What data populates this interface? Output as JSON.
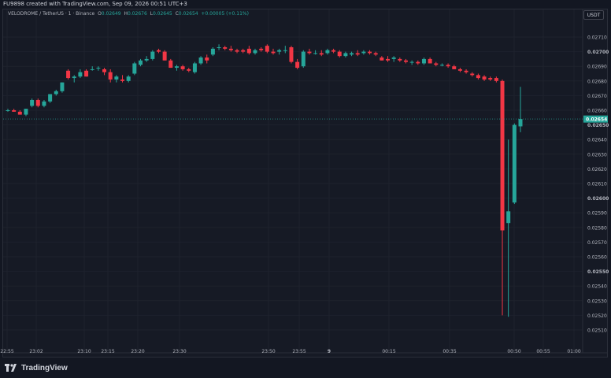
{
  "header": {
    "attribution": "FU9898 created with TradingView.com, Sep 09, 2026 00:51 UTC+3"
  },
  "legend": {
    "symbol": "VELODROME / TetherUS · 1 · Binance",
    "open_label": "O",
    "open": "0.02649",
    "high_label": "H",
    "high": "0.02676",
    "low_label": "L",
    "low": "0.02645",
    "close_label": "C",
    "close": "0.02654",
    "change": "+0.00005 (+0.11%)"
  },
  "currency_button": "USDT",
  "logo_text": "TradingView",
  "colors": {
    "up": "#26a69a",
    "down": "#f23645",
    "background": "#161a25",
    "grid": "#1e222d",
    "text": "#b2b5be",
    "price_line": "#26a69a"
  },
  "chart_data": {
    "type": "candlestick",
    "symbol": "VELODROME / TetherUS",
    "interval": "1",
    "exchange": "Binance",
    "ylim": [
      0.02512,
      0.02715
    ],
    "y_ticks": [
      "0.02710",
      "0.02700",
      "0.02690",
      "0.02680",
      "0.02670",
      "0.02660",
      "0.02650",
      "0.02640",
      "0.02630",
      "0.02620",
      "0.02610",
      "0.02600",
      "0.02590",
      "0.02580",
      "0.02570",
      "0.02560",
      "0.02550",
      "0.02540",
      "0.02530",
      "0.02520",
      "0.02510"
    ],
    "y_ticks_bold": [
      "0.02700",
      "0.02650",
      "0.02600",
      "0.02550"
    ],
    "x_ticks": [
      "22:55",
      "23:02",
      "23:10",
      "23:15",
      "23:20",
      "23:30",
      "23:50",
      "23:55",
      "9",
      "00:15",
      "00:35",
      "00:50",
      "00:55",
      "01:00"
    ],
    "current_price": "0.02654",
    "candles": [
      {
        "o": 0.0266,
        "h": 0.02661,
        "l": 0.02659,
        "c": 0.0266
      },
      {
        "o": 0.0266,
        "h": 0.02661,
        "l": 0.02659,
        "c": 0.02659
      },
      {
        "o": 0.02659,
        "h": 0.0266,
        "l": 0.02657,
        "c": 0.02657
      },
      {
        "o": 0.02657,
        "h": 0.02661,
        "l": 0.02656,
        "c": 0.02661
      },
      {
        "o": 0.02663,
        "h": 0.02668,
        "l": 0.02662,
        "c": 0.02667
      },
      {
        "o": 0.02667,
        "h": 0.02668,
        "l": 0.02662,
        "c": 0.02663
      },
      {
        "o": 0.02663,
        "h": 0.02667,
        "l": 0.02662,
        "c": 0.02666
      },
      {
        "o": 0.02666,
        "h": 0.02671,
        "l": 0.02665,
        "c": 0.02671
      },
      {
        "o": 0.02671,
        "h": 0.02674,
        "l": 0.0267,
        "c": 0.02673
      },
      {
        "o": 0.02673,
        "h": 0.02679,
        "l": 0.02672,
        "c": 0.02679
      },
      {
        "o": 0.02687,
        "h": 0.02688,
        "l": 0.02681,
        "c": 0.02682
      },
      {
        "o": 0.02682,
        "h": 0.02684,
        "l": 0.02679,
        "c": 0.02683
      },
      {
        "o": 0.02683,
        "h": 0.02688,
        "l": 0.02682,
        "c": 0.02686
      },
      {
        "o": 0.02687,
        "h": 0.02688,
        "l": 0.02683,
        "c": 0.02683
      },
      {
        "o": 0.02688,
        "h": 0.0269,
        "l": 0.02687,
        "c": 0.02688
      },
      {
        "o": 0.02689,
        "h": 0.0269,
        "l": 0.02687,
        "c": 0.02689
      },
      {
        "o": 0.02688,
        "h": 0.02689,
        "l": 0.02684,
        "c": 0.02686
      },
      {
        "o": 0.02686,
        "h": 0.02688,
        "l": 0.02679,
        "c": 0.02681
      },
      {
        "o": 0.02681,
        "h": 0.02684,
        "l": 0.02679,
        "c": 0.02683
      },
      {
        "o": 0.02681,
        "h": 0.02684,
        "l": 0.02679,
        "c": 0.0268
      },
      {
        "o": 0.0268,
        "h": 0.02684,
        "l": 0.02679,
        "c": 0.02683
      },
      {
        "o": 0.02685,
        "h": 0.02693,
        "l": 0.02684,
        "c": 0.02692
      },
      {
        "o": 0.02691,
        "h": 0.02695,
        "l": 0.0269,
        "c": 0.02694
      },
      {
        "o": 0.02694,
        "h": 0.02697,
        "l": 0.02693,
        "c": 0.02695
      },
      {
        "o": 0.02695,
        "h": 0.02701,
        "l": 0.02694,
        "c": 0.027
      },
      {
        "o": 0.02701,
        "h": 0.02702,
        "l": 0.02699,
        "c": 0.027
      },
      {
        "o": 0.027,
        "h": 0.02701,
        "l": 0.02694,
        "c": 0.02694
      },
      {
        "o": 0.02694,
        "h": 0.02695,
        "l": 0.02689,
        "c": 0.02689
      },
      {
        "o": 0.02689,
        "h": 0.02691,
        "l": 0.02687,
        "c": 0.0269
      },
      {
        "o": 0.0269,
        "h": 0.02691,
        "l": 0.02687,
        "c": 0.02688
      },
      {
        "o": 0.02688,
        "h": 0.02689,
        "l": 0.02686,
        "c": 0.02687
      },
      {
        "o": 0.02686,
        "h": 0.02693,
        "l": 0.02685,
        "c": 0.02692
      },
      {
        "o": 0.02692,
        "h": 0.02697,
        "l": 0.02691,
        "c": 0.02696
      },
      {
        "o": 0.02696,
        "h": 0.02698,
        "l": 0.02692,
        "c": 0.02694
      },
      {
        "o": 0.02698,
        "h": 0.02703,
        "l": 0.02697,
        "c": 0.02702
      },
      {
        "o": 0.02703,
        "h": 0.02705,
        "l": 0.02701,
        "c": 0.02703
      },
      {
        "o": 0.02703,
        "h": 0.02704,
        "l": 0.02701,
        "c": 0.02702
      },
      {
        "o": 0.02702,
        "h": 0.02704,
        "l": 0.027,
        "c": 0.02701
      },
      {
        "o": 0.02701,
        "h": 0.02702,
        "l": 0.02699,
        "c": 0.027
      },
      {
        "o": 0.02701,
        "h": 0.02702,
        "l": 0.02699,
        "c": 0.027
      },
      {
        "o": 0.02702,
        "h": 0.02704,
        "l": 0.02698,
        "c": 0.02699
      },
      {
        "o": 0.02699,
        "h": 0.02702,
        "l": 0.02698,
        "c": 0.02701
      },
      {
        "o": 0.02702,
        "h": 0.02703,
        "l": 0.027,
        "c": 0.02701
      },
      {
        "o": 0.02704,
        "h": 0.02705,
        "l": 0.02699,
        "c": 0.027
      },
      {
        "o": 0.027,
        "h": 0.02702,
        "l": 0.02698,
        "c": 0.02699
      },
      {
        "o": 0.027,
        "h": 0.02702,
        "l": 0.02698,
        "c": 0.02701
      },
      {
        "o": 0.02701,
        "h": 0.02704,
        "l": 0.02699,
        "c": 0.02701
      },
      {
        "o": 0.02703,
        "h": 0.02704,
        "l": 0.02692,
        "c": 0.02693
      },
      {
        "o": 0.02693,
        "h": 0.02695,
        "l": 0.02688,
        "c": 0.02689
      },
      {
        "o": 0.0269,
        "h": 0.02701,
        "l": 0.02689,
        "c": 0.027
      },
      {
        "o": 0.027,
        "h": 0.02702,
        "l": 0.02698,
        "c": 0.02699
      },
      {
        "o": 0.02699,
        "h": 0.02701,
        "l": 0.02698,
        "c": 0.02699
      },
      {
        "o": 0.02699,
        "h": 0.02701,
        "l": 0.02697,
        "c": 0.02698
      },
      {
        "o": 0.02699,
        "h": 0.02702,
        "l": 0.02698,
        "c": 0.02701
      },
      {
        "o": 0.02701,
        "h": 0.02702,
        "l": 0.02699,
        "c": 0.027
      },
      {
        "o": 0.027,
        "h": 0.02701,
        "l": 0.02696,
        "c": 0.02697
      },
      {
        "o": 0.02697,
        "h": 0.027,
        "l": 0.02696,
        "c": 0.02699
      },
      {
        "o": 0.02698,
        "h": 0.027,
        "l": 0.02697,
        "c": 0.02699
      },
      {
        "o": 0.02699,
        "h": 0.02701,
        "l": 0.02697,
        "c": 0.02698
      },
      {
        "o": 0.02699,
        "h": 0.02701,
        "l": 0.02698,
        "c": 0.027
      },
      {
        "o": 0.027,
        "h": 0.02701,
        "l": 0.02698,
        "c": 0.02699
      },
      {
        "o": 0.02699,
        "h": 0.027,
        "l": 0.02697,
        "c": 0.02698
      },
      {
        "o": 0.02696,
        "h": 0.02697,
        "l": 0.02694,
        "c": 0.02694
      },
      {
        "o": 0.02695,
        "h": 0.02697,
        "l": 0.02693,
        "c": 0.02694
      },
      {
        "o": 0.02695,
        "h": 0.02697,
        "l": 0.02693,
        "c": 0.02696
      },
      {
        "o": 0.02695,
        "h": 0.02696,
        "l": 0.02693,
        "c": 0.02694
      },
      {
        "o": 0.02694,
        "h": 0.02695,
        "l": 0.02692,
        "c": 0.02693
      },
      {
        "o": 0.02693,
        "h": 0.02694,
        "l": 0.02691,
        "c": 0.02693
      },
      {
        "o": 0.02693,
        "h": 0.02694,
        "l": 0.02691,
        "c": 0.02692
      },
      {
        "o": 0.02692,
        "h": 0.02696,
        "l": 0.02691,
        "c": 0.02695
      },
      {
        "o": 0.02695,
        "h": 0.02696,
        "l": 0.02692,
        "c": 0.02692
      },
      {
        "o": 0.02692,
        "h": 0.02693,
        "l": 0.0269,
        "c": 0.02691
      },
      {
        "o": 0.02691,
        "h": 0.02692,
        "l": 0.0269,
        "c": 0.02691
      },
      {
        "o": 0.02691,
        "h": 0.02692,
        "l": 0.02689,
        "c": 0.0269
      },
      {
        "o": 0.0269,
        "h": 0.02691,
        "l": 0.02688,
        "c": 0.02688
      },
      {
        "o": 0.02688,
        "h": 0.02689,
        "l": 0.02686,
        "c": 0.02687
      },
      {
        "o": 0.02687,
        "h": 0.02688,
        "l": 0.02685,
        "c": 0.02686
      },
      {
        "o": 0.02685,
        "h": 0.02686,
        "l": 0.02683,
        "c": 0.02684
      },
      {
        "o": 0.02684,
        "h": 0.02685,
        "l": 0.02681,
        "c": 0.02682
      },
      {
        "o": 0.02683,
        "h": 0.02684,
        "l": 0.0268,
        "c": 0.02681
      },
      {
        "o": 0.02682,
        "h": 0.02683,
        "l": 0.0268,
        "c": 0.02681
      },
      {
        "o": 0.02682,
        "h": 0.02683,
        "l": 0.02679,
        "c": 0.0268
      },
      {
        "o": 0.0268,
        "h": 0.02681,
        "l": 0.0252,
        "c": 0.02578
      },
      {
        "o": 0.02583,
        "h": 0.0264,
        "l": 0.02519,
        "c": 0.02591
      },
      {
        "o": 0.02597,
        "h": 0.02651,
        "l": 0.02596,
        "c": 0.0265
      },
      {
        "o": 0.02649,
        "h": 0.02676,
        "l": 0.02645,
        "c": 0.02654
      }
    ]
  }
}
